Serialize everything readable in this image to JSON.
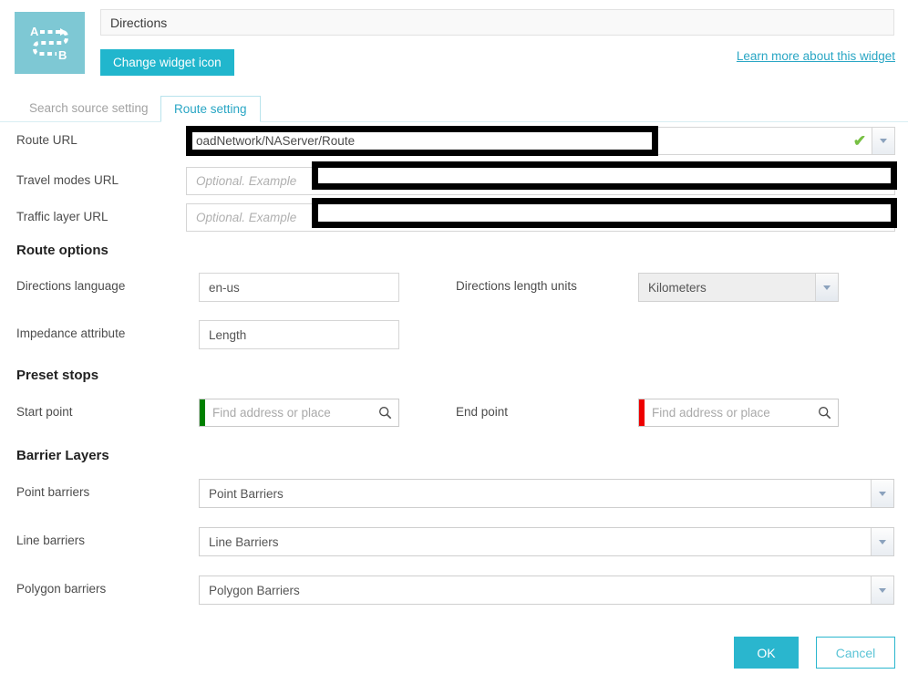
{
  "header": {
    "widget_icon_name": "directions-route-icon",
    "widget_icon_bg": "#7ec8d4",
    "title_value": "Directions",
    "title_placeholder": "Widget title",
    "change_icon_label": "Change widget icon",
    "learn_more_label": "Learn more about this widget"
  },
  "tabs": [
    {
      "label": "Search source setting",
      "active": false
    },
    {
      "label": "Route setting",
      "active": true
    }
  ],
  "route_setting": {
    "route_url": {
      "label": "Route URL",
      "value": "oadNetwork/NAServer/Route",
      "valid_icon": "green-check-icon",
      "valid_color": "#77c043",
      "redacted": true
    },
    "travel_modes_url": {
      "label": "Travel modes URL",
      "value": "",
      "placeholder": "Optional. Example",
      "redacted": true
    },
    "traffic_layer_url": {
      "label": "Traffic layer URL",
      "value": "",
      "placeholder": "Optional. Example",
      "redacted": true
    }
  },
  "route_options": {
    "heading": "Route options",
    "directions_language": {
      "label": "Directions language",
      "value": "en-us"
    },
    "directions_length_units": {
      "label": "Directions length units",
      "value": "Kilometers"
    },
    "impedance_attribute": {
      "label": "Impedance attribute",
      "value": "Length"
    }
  },
  "preset_stops": {
    "heading": "Preset stops",
    "start_point": {
      "label": "Start point",
      "value": "",
      "placeholder": "Find address or place",
      "marker_color": "#008000",
      "icon": "search-icon"
    },
    "end_point": {
      "label": "End point",
      "value": "",
      "placeholder": "Find address or place",
      "marker_color": "#ee0000",
      "icon": "search-icon"
    }
  },
  "barrier_layers": {
    "heading": "Barrier Layers",
    "point_barriers": {
      "label": "Point barriers",
      "value": "Point Barriers"
    },
    "line_barriers": {
      "label": "Line barriers",
      "value": "Line Barriers"
    },
    "polygon_barriers": {
      "label": "Polygon barriers",
      "value": "Polygon Barriers"
    }
  },
  "footer": {
    "ok_label": "OK",
    "cancel_label": "Cancel"
  },
  "colors": {
    "accent": "#2ab6ce",
    "link": "#29a6c4",
    "tab_active": "#29a6c4"
  }
}
